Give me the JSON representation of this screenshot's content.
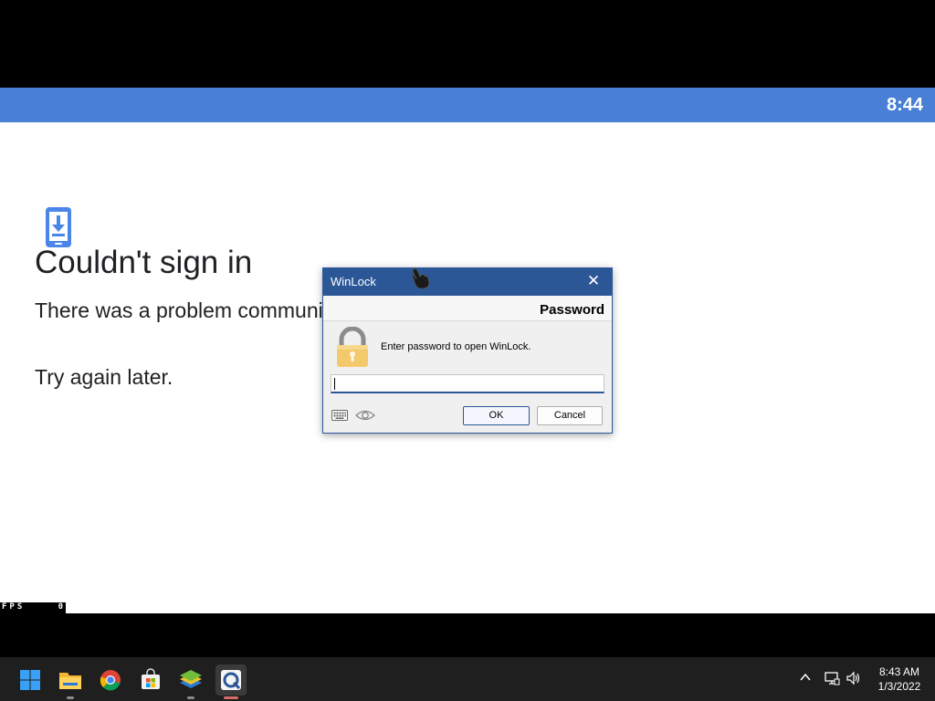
{
  "emulator": {
    "status_time": "8:44",
    "fps_label": "FPS",
    "fps_value": "0",
    "accent": "#4a7fd6"
  },
  "signin_error": {
    "title": "Couldn't sign in",
    "message": "There was a problem communicating with Google servers.",
    "retry": "Try again later.",
    "icon": "phone-download-icon"
  },
  "dialog": {
    "title": "WinLock",
    "close_glyph": "✕",
    "header": "Password",
    "prompt": "Enter password to open WinLock.",
    "password_value": "",
    "ok_label": "OK",
    "cancel_label": "Cancel",
    "title_color": "#2b5797"
  },
  "taskbar": {
    "apps": [
      "start-icon",
      "file-explorer-icon",
      "chrome-icon",
      "store-icon",
      "bluestacks-icon",
      "winlock-icon"
    ],
    "clock_time": "8:43 AM",
    "clock_date": "1/3/2022"
  }
}
